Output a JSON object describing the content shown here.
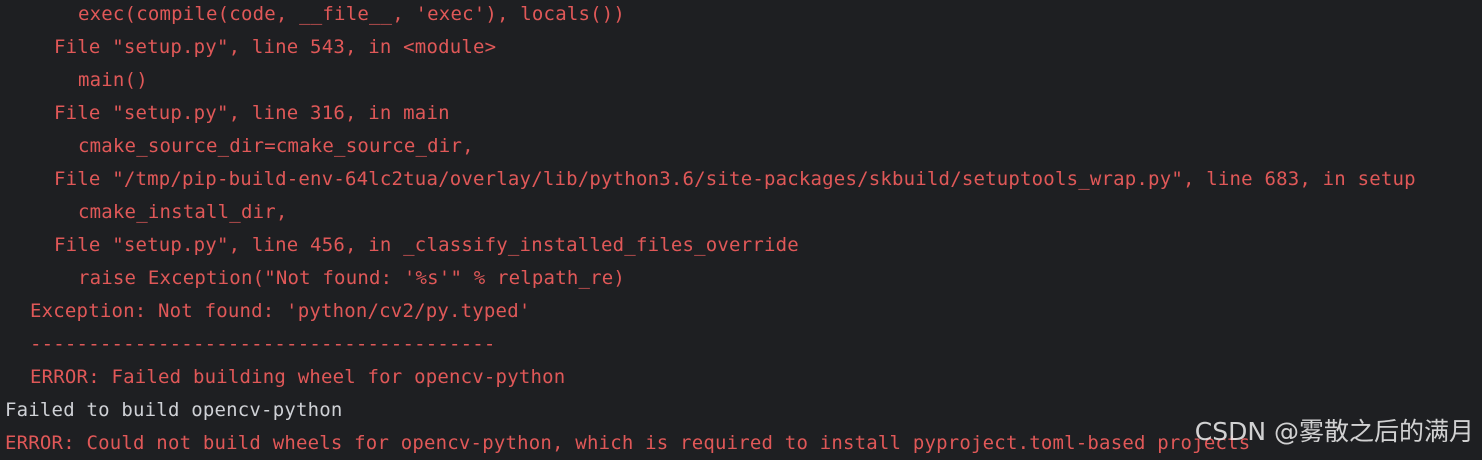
{
  "terminal": {
    "lines": [
      "exec(compile(code, __file__, 'exec'), locals())",
      "File \"setup.py\", line 543, in <module>",
      "main()",
      "File \"setup.py\", line 316, in main",
      "cmake_source_dir=cmake_source_dir,",
      "File \"/tmp/pip-build-env-64lc2tua/overlay/lib/python3.6/site-packages/skbuild/setuptools_wrap.py\", line 683, in setup",
      "cmake_install_dir,",
      "File \"setup.py\", line 456, in _classify_installed_files_override",
      "raise Exception(\"Not found: '%s'\" % relpath_re)",
      "Exception: Not found: 'python/cv2/py.typed'",
      "----------------------------------------",
      "ERROR: Failed building wheel for opencv-python",
      "Failed to build opencv-python",
      "ERROR: Could not build wheels for opencv-python, which is required to install pyproject.toml-based projects"
    ]
  },
  "watermark": {
    "text": "CSDN @雾散之后的满月"
  },
  "colors": {
    "background": "#1e1f22",
    "error_text": "#e05858",
    "normal_text": "#cfd1d6"
  }
}
